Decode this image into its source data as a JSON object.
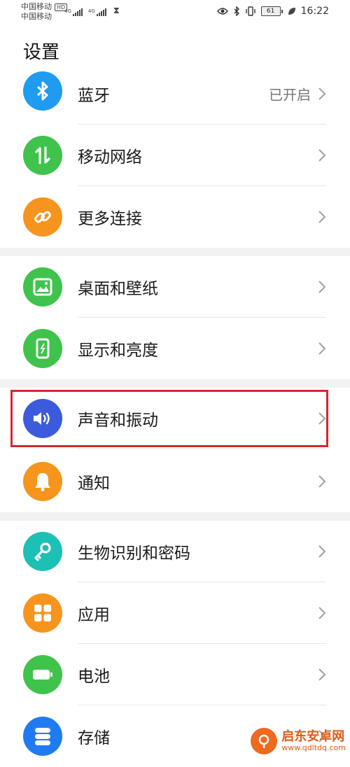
{
  "status_bar": {
    "carrier_1": "中国移动",
    "carrier_1_badge": "HD",
    "carrier_2": "中国移动",
    "network_1": "4G",
    "network_2": "4G",
    "battery_level": "61",
    "time": "16:22",
    "icons": [
      "eye-icon",
      "bluetooth-icon",
      "vibrate-icon",
      "battery-icon",
      "leaf-icon",
      "hourglass-icon"
    ]
  },
  "page": {
    "title": "设置"
  },
  "settings": [
    {
      "label": "蓝牙",
      "value": "已开启",
      "icon": "bluetooth-icon",
      "color": "#1f9bf0"
    },
    {
      "label": "移动网络",
      "value": "",
      "icon": "mobile-data-icon",
      "color": "#3fc34c"
    },
    {
      "label": "更多连接",
      "value": "",
      "icon": "link-icon",
      "color": "#f7941d"
    },
    {
      "label": "桌面和壁纸",
      "value": "",
      "icon": "wallpaper-icon",
      "color": "#3fc34c"
    },
    {
      "label": "显示和亮度",
      "value": "",
      "icon": "display-icon",
      "color": "#3fc34c"
    },
    {
      "label": "声音和振动",
      "value": "",
      "icon": "sound-icon",
      "color": "#3c5bdc"
    },
    {
      "label": "通知",
      "value": "",
      "icon": "bell-icon",
      "color": "#f7941d"
    },
    {
      "label": "生物识别和密码",
      "value": "",
      "icon": "key-icon",
      "color": "#1cc0b4"
    },
    {
      "label": "应用",
      "value": "",
      "icon": "apps-icon",
      "color": "#f7941d"
    },
    {
      "label": "电池",
      "value": "",
      "icon": "battery-setting-icon",
      "color": "#3fc34c"
    },
    {
      "label": "存储",
      "value": "",
      "icon": "storage-icon",
      "color": "#1f7cf0"
    }
  ],
  "colors": {
    "highlight": "#d8262b",
    "section_gap": "#f2f2f2"
  },
  "watermark": {
    "name": "启东安卓网",
    "url": "www.qdltdq.com"
  }
}
